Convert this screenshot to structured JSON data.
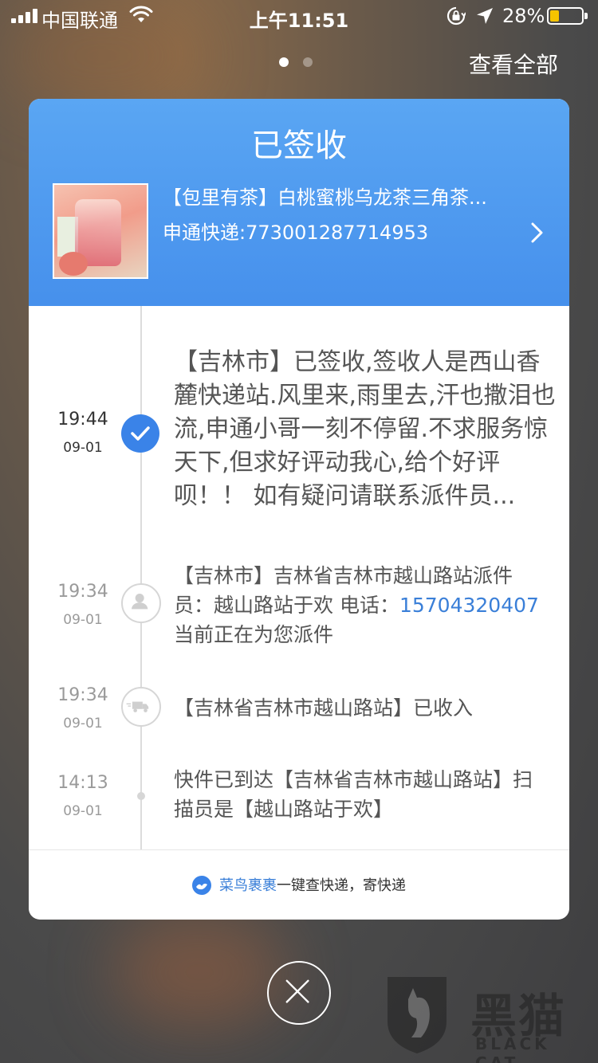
{
  "status_bar": {
    "carrier": "中国联通",
    "time": "上午11:51",
    "battery_percent": "28%",
    "battery_level": 0.28
  },
  "header": {
    "view_all_label": "查看全部",
    "page_count": 2,
    "active_page": 1
  },
  "card": {
    "title": "已签收",
    "product_name": "【包里有茶】白桃蜜桃乌龙茶三角茶...",
    "tracking": "申通快递:773001287714953",
    "accent_color": "#4690ec"
  },
  "timeline": [
    {
      "time": "19:44",
      "date": "09-01",
      "text": "【吉林市】已签收,签收人是西山香麓快递站.风里来,雨里去,汗也撒泪也流,申通小哥一刻不停留.不求服务惊天下,但求好评动我心,给个好评呗！！ 如有疑问请联系派件员...",
      "icon": "check-icon"
    },
    {
      "time": "19:34",
      "date": "09-01",
      "text_before": "【吉林市】吉林省吉林市越山路站派件员：越山路站于欢 电话：",
      "phone": "15704320407",
      "text_after": " 当前正在为您派件",
      "icon": "person-icon"
    },
    {
      "time": "19:34",
      "date": "09-01",
      "text": "【吉林省吉林市越山路站】已收入",
      "icon": "truck-icon"
    },
    {
      "time": "14:13",
      "date": "09-01",
      "text": "快件已到达【吉林省吉林市越山路站】扫描员是【越山路站于欢】",
      "icon": "dot-icon"
    }
  ],
  "footer": {
    "brand": "菜鸟裹裹",
    "slogan": "一键查快递，寄快递"
  },
  "watermark": {
    "cn": "黑猫",
    "en": "BLACK CAT"
  }
}
